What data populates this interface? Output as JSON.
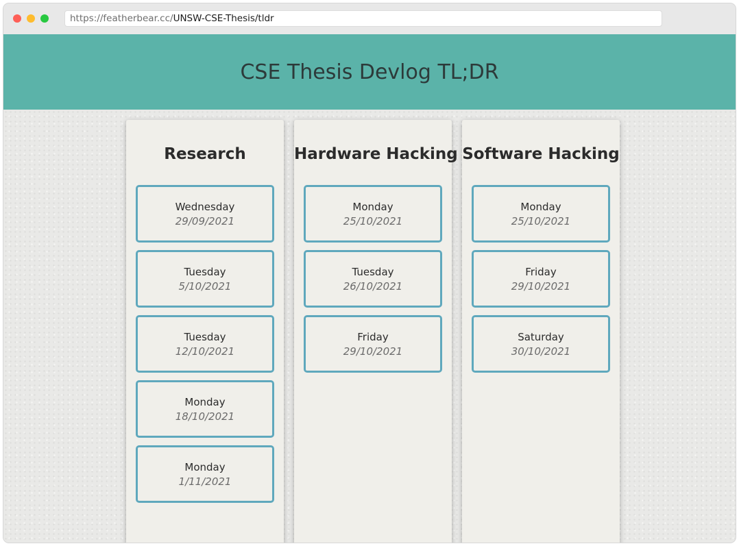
{
  "browser": {
    "url_host": "https://featherbear.cc/",
    "url_path": "UNSW-CSE-Thesis/tldr"
  },
  "header": {
    "title": "CSE Thesis Devlog TL;DR"
  },
  "columns": [
    {
      "title": "Research",
      "entries": [
        {
          "day": "Wednesday",
          "date": "29/09/2021"
        },
        {
          "day": "Tuesday",
          "date": "5/10/2021"
        },
        {
          "day": "Tuesday",
          "date": "12/10/2021"
        },
        {
          "day": "Monday",
          "date": "18/10/2021"
        },
        {
          "day": "Monday",
          "date": "1/11/2021"
        }
      ]
    },
    {
      "title": "Hardware Hacking",
      "entries": [
        {
          "day": "Monday",
          "date": "25/10/2021"
        },
        {
          "day": "Tuesday",
          "date": "26/10/2021"
        },
        {
          "day": "Friday",
          "date": "29/10/2021"
        }
      ]
    },
    {
      "title": "Software Hacking",
      "entries": [
        {
          "day": "Monday",
          "date": "25/10/2021"
        },
        {
          "day": "Friday",
          "date": "29/10/2021"
        },
        {
          "day": "Saturday",
          "date": "30/10/2021"
        }
      ]
    }
  ],
  "colors": {
    "header_bg": "#5bb3a9",
    "card_border": "#5fa8bd",
    "column_bg": "#f0efea"
  }
}
